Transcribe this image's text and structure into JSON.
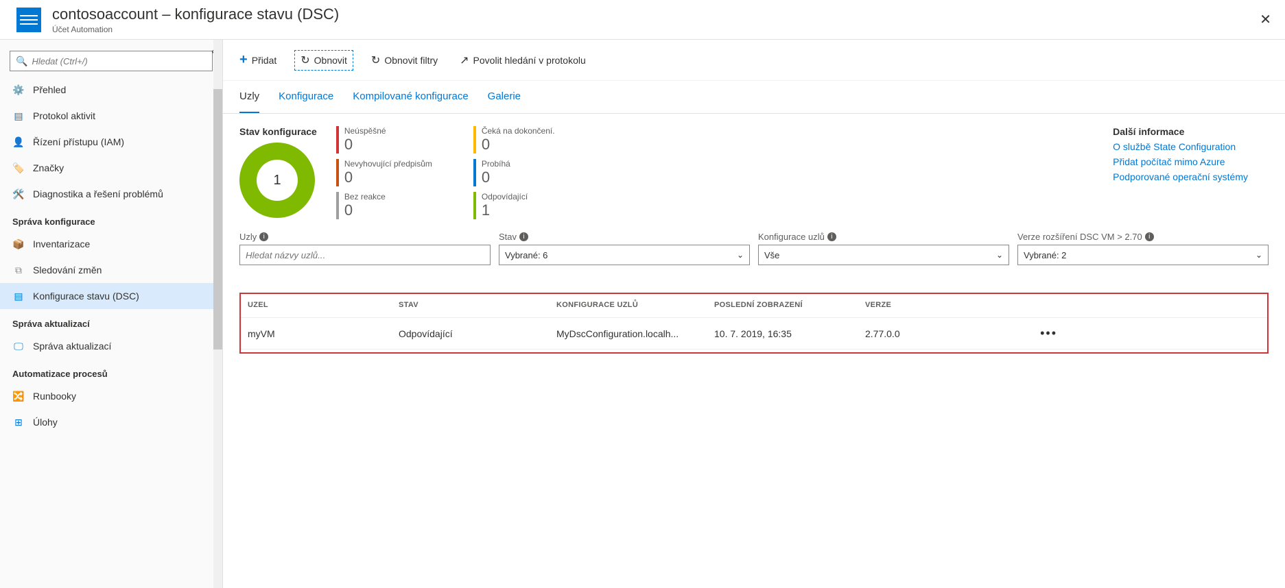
{
  "header": {
    "title": "contosoaccount – konfigurace stavu (DSC)",
    "subtitle": "Účet Automation"
  },
  "sidebar": {
    "search_placeholder": "Hledat (Ctrl+/)",
    "items": [
      {
        "label": "Přehled",
        "icon": "overview"
      },
      {
        "label": "Protokol aktivit",
        "icon": "log"
      },
      {
        "label": "Řízení přístupu (IAM)",
        "icon": "iam"
      },
      {
        "label": "Značky",
        "icon": "tags"
      },
      {
        "label": "Diagnostika a řešení problémů",
        "icon": "diagnose"
      }
    ],
    "groups": [
      {
        "title": "Správa konfigurace",
        "items": [
          {
            "label": "Inventarizace"
          },
          {
            "label": "Sledování změn"
          },
          {
            "label": "Konfigurace stavu (DSC)",
            "active": true
          }
        ]
      },
      {
        "title": "Správa aktualizací",
        "items": [
          {
            "label": "Správa aktualizací"
          }
        ]
      },
      {
        "title": "Automatizace procesů",
        "items": [
          {
            "label": "Runbooky"
          },
          {
            "label": "Úlohy"
          }
        ]
      }
    ]
  },
  "toolbar": {
    "add": "Přidat",
    "refresh": "Obnovit",
    "refresh_filters": "Obnovit filtry",
    "enable_log": "Povolit hledání v protokolu"
  },
  "tabs": [
    "Uzly",
    "Konfigurace",
    "Kompilované konfigurace",
    "Galerie"
  ],
  "status": {
    "title": "Stav konfigurace",
    "donut_total": "1",
    "items": [
      {
        "label": "Neúspěšné",
        "value": "0",
        "color": "red"
      },
      {
        "label": "Čeká na dokončení.",
        "value": "0",
        "color": "yellow"
      },
      {
        "label": "Nevyhovující předpisům",
        "value": "0",
        "color": "orange"
      },
      {
        "label": "Probíhá",
        "value": "0",
        "color": "blue"
      },
      {
        "label": "Bez reakce",
        "value": "0",
        "color": "gray"
      },
      {
        "label": "Odpovídající",
        "value": "1",
        "color": "green"
      }
    ]
  },
  "info_links": {
    "title": "Další informace",
    "links": [
      "O službě State Configuration",
      "Přidat počítač mimo Azure",
      "Podporované operační systémy"
    ]
  },
  "filters": {
    "nodes": {
      "label": "Uzly",
      "placeholder": "Hledat názvy uzlů..."
    },
    "state": {
      "label": "Stav",
      "value": "Vybrané: 6"
    },
    "node_config": {
      "label": "Konfigurace uzlů",
      "value": "Vše"
    },
    "version": {
      "label": "Verze rozšíření DSC VM > 2.70",
      "value": "Vybrané: 2"
    }
  },
  "table": {
    "headers": [
      "UZEL",
      "STAV",
      "KONFIGURACE UZLŮ",
      "POSLEDNÍ ZOBRAZENÍ",
      "VERZE"
    ],
    "rows": [
      {
        "node": "myVM",
        "state": "Odpovídající",
        "config": "MyDscConfiguration.localh...",
        "last": "10. 7. 2019, 16:35",
        "version": "2.77.0.0"
      }
    ]
  },
  "chart_data": {
    "type": "pie",
    "title": "Stav konfigurace",
    "categories": [
      "Neúspěšné",
      "Čeká na dokončení.",
      "Nevyhovující předpisům",
      "Probíhá",
      "Bez reakce",
      "Odpovídající"
    ],
    "values": [
      0,
      0,
      0,
      0,
      0,
      1
    ],
    "total": 1
  }
}
